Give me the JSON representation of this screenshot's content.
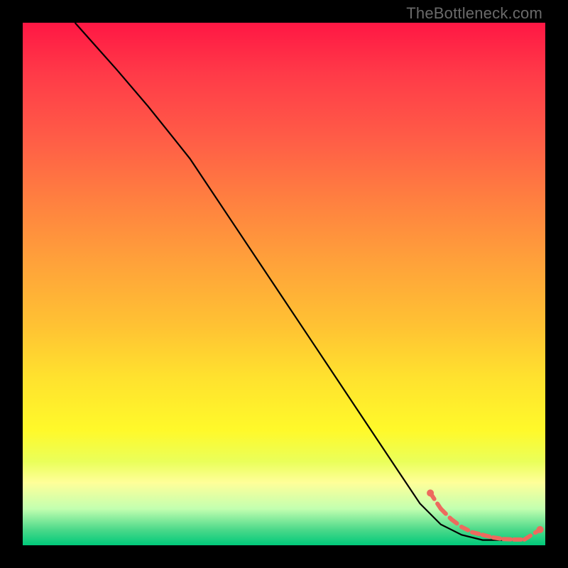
{
  "watermark": "TheBottleneck.com",
  "chart_data": {
    "type": "line",
    "title": "",
    "xlabel": "",
    "ylabel": "",
    "xlim": [
      0,
      100
    ],
    "ylim": [
      0,
      100
    ],
    "grid": false,
    "legend": false,
    "series": [
      {
        "name": "curve",
        "style": "line",
        "color": "#000000",
        "x": [
          10,
          18,
          24,
          28,
          32,
          40,
          48,
          56,
          64,
          72,
          76,
          80,
          84,
          88,
          92,
          96
        ],
        "y": [
          100,
          91,
          84,
          79,
          74,
          62,
          50,
          38,
          26,
          14,
          8,
          4,
          2,
          1,
          1,
          1
        ]
      },
      {
        "name": "valley-points",
        "style": "dashed-marker",
        "color": "#ed6a5e",
        "x": [
          78,
          80,
          82,
          84,
          86,
          88,
          90,
          92,
          94,
          96,
          99
        ],
        "y": [
          10,
          7,
          5,
          3.5,
          2.5,
          2,
          1.5,
          1.2,
          1.1,
          1.1,
          3
        ]
      }
    ]
  }
}
